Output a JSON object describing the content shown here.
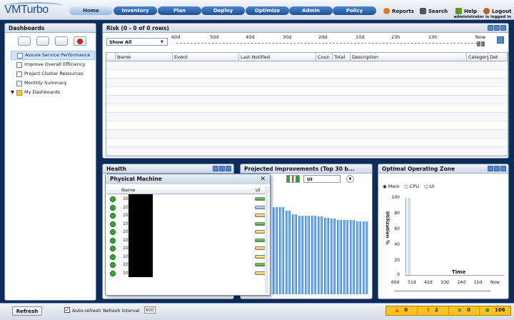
{
  "app": {
    "logo": "VMTurbo"
  },
  "nav": [
    "Home",
    "Inventory",
    "Plan",
    "Deploy",
    "Optimize",
    "Admin",
    "Policy"
  ],
  "toplinks": {
    "reports": "Reports",
    "search": "Search",
    "help": "Help",
    "logout": "Logout",
    "logged_in": "administrator is logged in"
  },
  "sidebar": {
    "title": "Dashboards",
    "items": [
      "Assure Service Performance",
      "Improve Overall Efficiency",
      "Project Cluster Resources",
      "Monthly Summary"
    ],
    "folder": "My Dashboards"
  },
  "risk": {
    "title": "Risk (0 - 0 of 0 rows)",
    "filter": "Show All",
    "timeline": [
      "60d",
      "50d",
      "40d",
      "30d",
      "20d",
      "10d",
      "23h",
      "13h",
      "Now"
    ],
    "columns": [
      "Name",
      "Event",
      "Last Notified",
      "Coun",
      "Total",
      "Description",
      "Category",
      "Det"
    ]
  },
  "health": {
    "title": "Health"
  },
  "projected": {
    "title": "Projected Improvements (Top 30 b...",
    "select": "UI",
    "bars": [
      100,
      100,
      96,
      92,
      90,
      90,
      90,
      89,
      88,
      87,
      85,
      85,
      85,
      84,
      84
    ]
  },
  "physical_machine": {
    "title": "Physical Machine",
    "col_name": "Name",
    "col_ui": "UI",
    "rows": [
      {
        "name": "10.",
        "status": "green"
      },
      {
        "name": "10.",
        "status": "blue"
      },
      {
        "name": "10.",
        "status": "yellow"
      },
      {
        "name": "10.",
        "status": "green"
      },
      {
        "name": "10.",
        "status": "yellow"
      },
      {
        "name": "10.",
        "status": "green"
      },
      {
        "name": "10.",
        "status": "yellow"
      },
      {
        "name": "10.",
        "status": "yellow"
      },
      {
        "name": "10.",
        "status": "green"
      },
      {
        "name": "10.",
        "status": "yellow"
      }
    ]
  },
  "ooz": {
    "title": "Optimal Operating Zone",
    "options": [
      "Mem",
      "CPU",
      "UI"
    ],
    "yaxis": [
      "100",
      "80",
      "60",
      "40",
      "20",
      "0"
    ],
    "ylabel": "Utilization %",
    "xlabel": "Time",
    "xticks": [
      "60d",
      "51d",
      "42d",
      "33d",
      "24d",
      "15d",
      "Now"
    ]
  },
  "bottom": {
    "refresh": "Refresh",
    "auto_refresh": "Auto-refresh",
    "interval_label": "Refresh Interval",
    "interval_value": "600"
  },
  "alerts": {
    "major": "0",
    "critical": "2",
    "minor": "0",
    "ok": "106"
  }
}
